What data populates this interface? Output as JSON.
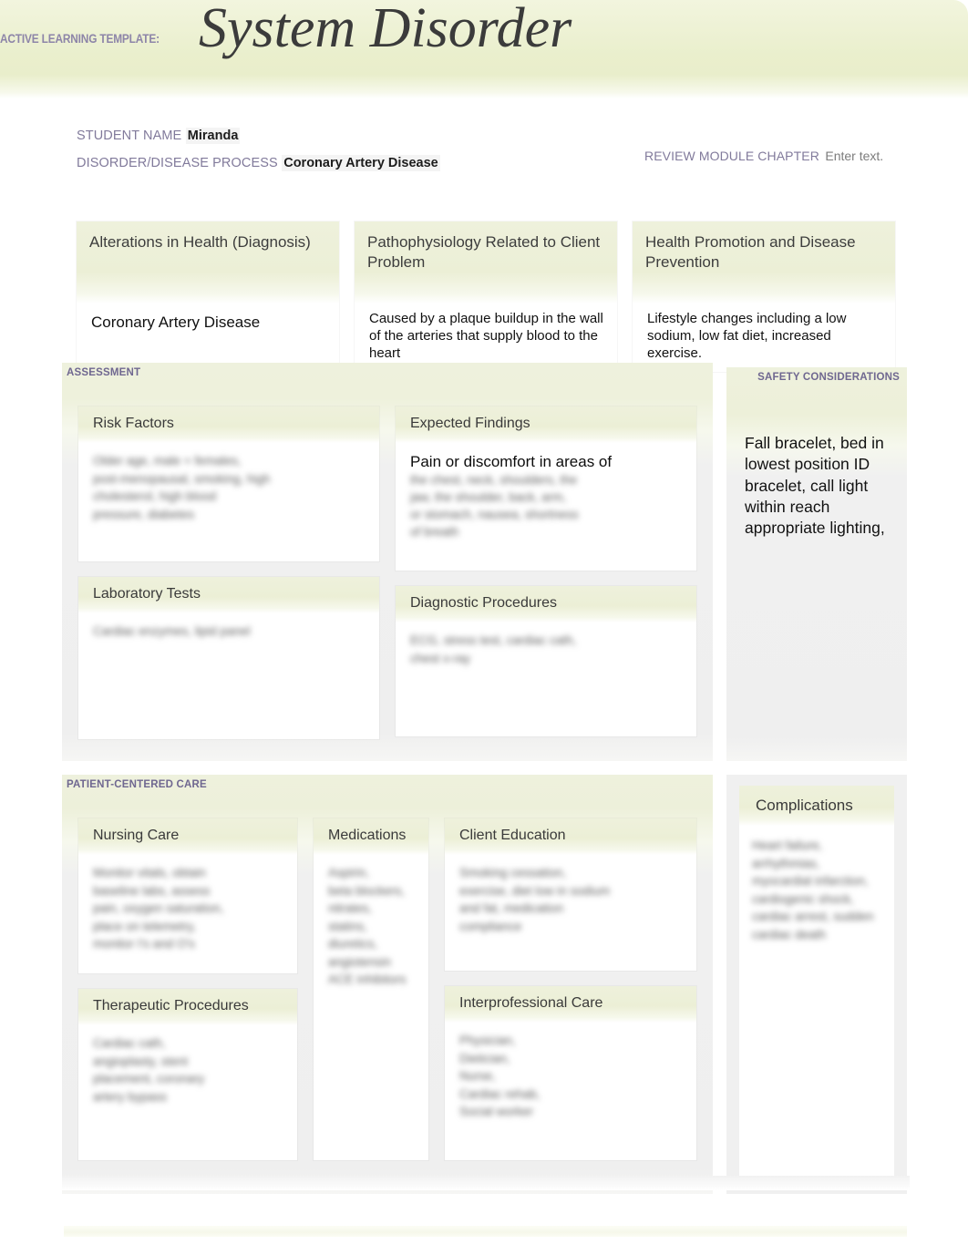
{
  "header": {
    "template_label": "ACTIVE LEARNING TEMPLATE:",
    "title": "System Disorder",
    "banner_color": "#eaefcd",
    "label_color": "#8d85a8"
  },
  "meta": {
    "student_name_label": "STUDENT NAME",
    "student_name_value": "Miranda",
    "disorder_label": "DISORDER/DISEASE PROCESS",
    "disorder_value": "Coronary Artery Disease",
    "review_module_label": "REVIEW MODULE CHAPTER",
    "review_module_value": "Enter text."
  },
  "top_cards": [
    {
      "title": "Alterations in Health (Diagnosis)",
      "body": "Coronary Artery Disease"
    },
    {
      "title": "Pathophysiology Related to Client Problem",
      "body": "Caused by a plaque buildup in the wall of the arteries that supply blood to the heart"
    },
    {
      "title": "Health Promotion and Disease Prevention",
      "body": "Lifestyle changes including a low sodium, low fat diet, increased exercise."
    }
  ],
  "assessment": {
    "section_label": "ASSESSMENT",
    "risk_factors": {
      "title": "Risk Factors",
      "body_redacted": "Older age, male + females,\npost-menopausal, smoking, high\ncholesterol, high blood\npressure, diabetes"
    },
    "laboratory_tests": {
      "title": "Laboratory Tests",
      "body_redacted": "Cardiac enzymes, lipid panel"
    },
    "expected_findings": {
      "title": "Expected Findings",
      "body_visible": "Pain or discomfort in areas of",
      "body_redacted": "the chest, neck, shoulders, the\njaw, the shoulder, back, arm,\nor stomach, nausea, shortness\nof breath"
    },
    "diagnostic_procedures": {
      "title": "Diagnostic Procedures",
      "body_redacted": "ECG, stress test, cardiac cath,\nchest x-ray"
    }
  },
  "safety": {
    "section_label": "SAFETY CONSIDERATIONS",
    "body": "Fall bracelet, bed in lowest position ID bracelet, call light within reach appropriate lighting,"
  },
  "patient_centered_care": {
    "section_label": "PATIENT-CENTERED CARE",
    "nursing_care": {
      "title": "Nursing Care",
      "body_redacted": "Monitor vitals, obtain\nbaseline labs, assess\npain, oxygen saturation,\nplace on telemetry,\nmonitor I's and O's"
    },
    "therapeutic_procedures": {
      "title": "Therapeutic Procedures",
      "body_redacted": "Cardiac cath,\nangioplasty, stent\nplacement, coronary\nartery bypass"
    },
    "medications": {
      "title": "Medications",
      "body_redacted": "Aspirin,\nbeta blockers,\nnitrates,\nstatins,\ndiuretics,\nangiotensin\nACE inhibitors"
    },
    "client_education": {
      "title": "Client Education",
      "body_redacted": "Smoking cessation,\nexercise, diet low in sodium\nand fat, medication\ncompliance"
    },
    "interprofessional_care": {
      "title": "Interprofessional Care",
      "body_redacted": "Physician,\nDietician,\nNurse,\nCardiac rehab,\nSocial worker"
    }
  },
  "complications": {
    "title": "Complications",
    "body_redacted": "Heart failure, arrhythmias,\nmyocardial infarction,\ncardiogenic shock,\ncardiac arrest, sudden\ncardiac death"
  }
}
